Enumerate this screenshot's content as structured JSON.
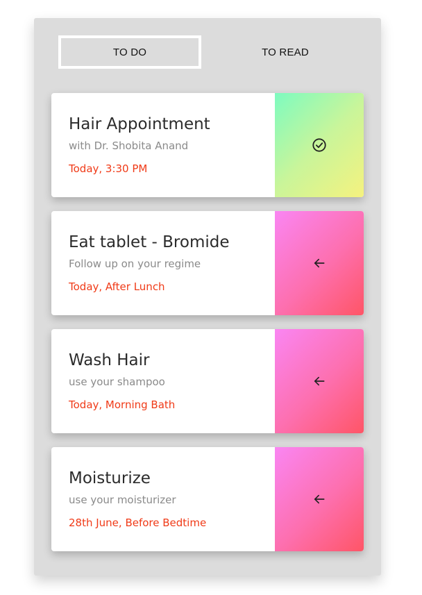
{
  "tabs": [
    {
      "label": "TO DO",
      "active": true
    },
    {
      "label": "TO READ",
      "active": false
    }
  ],
  "cards": [
    {
      "title": "Hair Appointment",
      "subtitle": "with Dr. Shobita Anand",
      "time": "Today, 3:30 PM",
      "action_icon": "check-circle-icon"
    },
    {
      "title": "Eat tablet - Bromide",
      "subtitle": "Follow up on your regime",
      "time": "Today, After Lunch",
      "action_icon": "arrow-left-icon"
    },
    {
      "title": "Wash Hair",
      "subtitle": "use your shampoo",
      "time": "Today, Morning Bath",
      "action_icon": "arrow-left-icon"
    },
    {
      "title": "Moisturize",
      "subtitle": "use your moisturizer",
      "time": "28th June, Before Bedtime",
      "action_icon": "arrow-left-icon"
    }
  ],
  "colors": {
    "panel_bg": "#dcdcdc",
    "time_text": "#f03a17",
    "done_gradient": [
      "#7dfbc0",
      "#f5f27f"
    ],
    "pending_gradient": [
      "#fa86f3",
      "#ff5566"
    ]
  }
}
